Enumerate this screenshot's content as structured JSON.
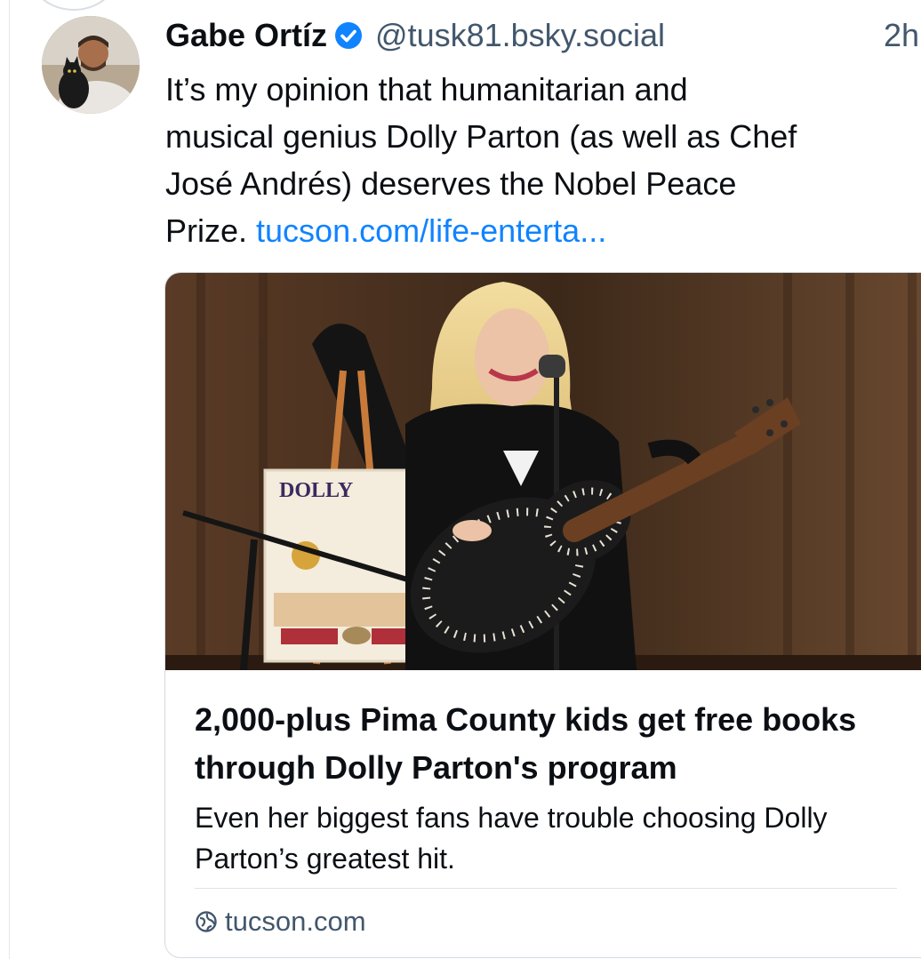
{
  "post": {
    "author": {
      "display_name": "Gabe Ortíz",
      "handle": "@tusk81.bsky.social",
      "verified": true
    },
    "timestamp": "2h",
    "text_lines": [
      "It’s my opinion that humanitarian and",
      "musical genius Dolly Parton (as well as Chef",
      "José Andrés) deserves the Nobel Peace"
    ],
    "text_last_prefix": "Prize. ",
    "link_text": "tucson.com/life-enterta...",
    "embed": {
      "image_alt": "Dolly Parton singing at a microphone holding a pearl-studded guitar beside a Dolly Parton book poster",
      "poster_text": "DOLLY",
      "title": "2,000-plus Pima County kids get free books through Dolly Parton's program",
      "description": "Even her biggest fans have trouble choosing Dolly Parton’s greatest hit.",
      "domain": "tucson.com"
    }
  },
  "colors": {
    "accent": "#1083fe",
    "muted_text": "#42576c",
    "border": "#d4dbe2"
  },
  "icons": {
    "verified": "verified-badge-icon",
    "globe": "globe-icon"
  }
}
